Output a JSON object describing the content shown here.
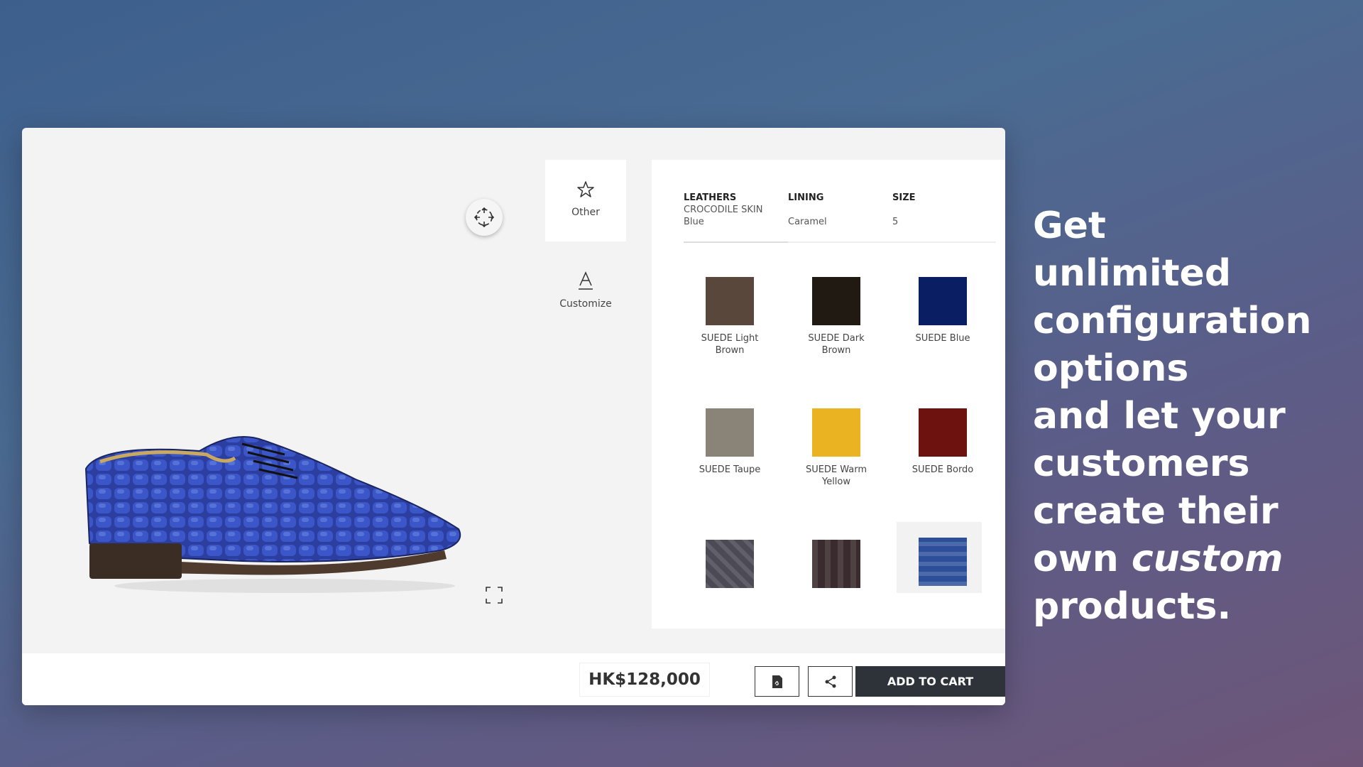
{
  "side_tabs": [
    {
      "label": "Other",
      "icon": "star-icon"
    },
    {
      "label": "Customize",
      "icon": "text-a-icon"
    }
  ],
  "categories": [
    {
      "title": "LEATHERS",
      "value_line1": "CROCODILE SKIN",
      "value_line2": "Blue"
    },
    {
      "title": "LINING",
      "value_line1": "",
      "value_line2": "Caramel"
    },
    {
      "title": "SIZE",
      "value_line1": "",
      "value_line2": "5"
    }
  ],
  "swatches": [
    {
      "label": "SUEDE Light Brown",
      "color": "#5a473b"
    },
    {
      "label": "SUEDE Dark Brown",
      "color": "#211a12"
    },
    {
      "label": "SUEDE Blue",
      "color": "#0a1f63"
    },
    {
      "label": "SUEDE Taupe",
      "color": "#8a8377"
    },
    {
      "label": "SUEDE Warm Yellow",
      "color": "#e9b322"
    },
    {
      "label": "SUEDE Bordo",
      "color": "#6e1210"
    },
    {
      "label": "",
      "color": "#4b4a55"
    },
    {
      "label": "",
      "color": "#3a2c2e"
    },
    {
      "label": "",
      "color": "#2d4f9a"
    }
  ],
  "footer": {
    "price": "HK$128,000",
    "add_to_cart": "ADD TO CART"
  },
  "headline": {
    "line1": "Get",
    "line2": "unlimited",
    "line3": "configuration",
    "line4": "options",
    "line5": "and let your",
    "line6": "customers",
    "line7": "create their",
    "line8_a": "own ",
    "line8_b": "custom",
    "line9": "products."
  },
  "colors": {
    "cart_button": "#2d3339",
    "shoe_leather": "#2c3fa0"
  }
}
